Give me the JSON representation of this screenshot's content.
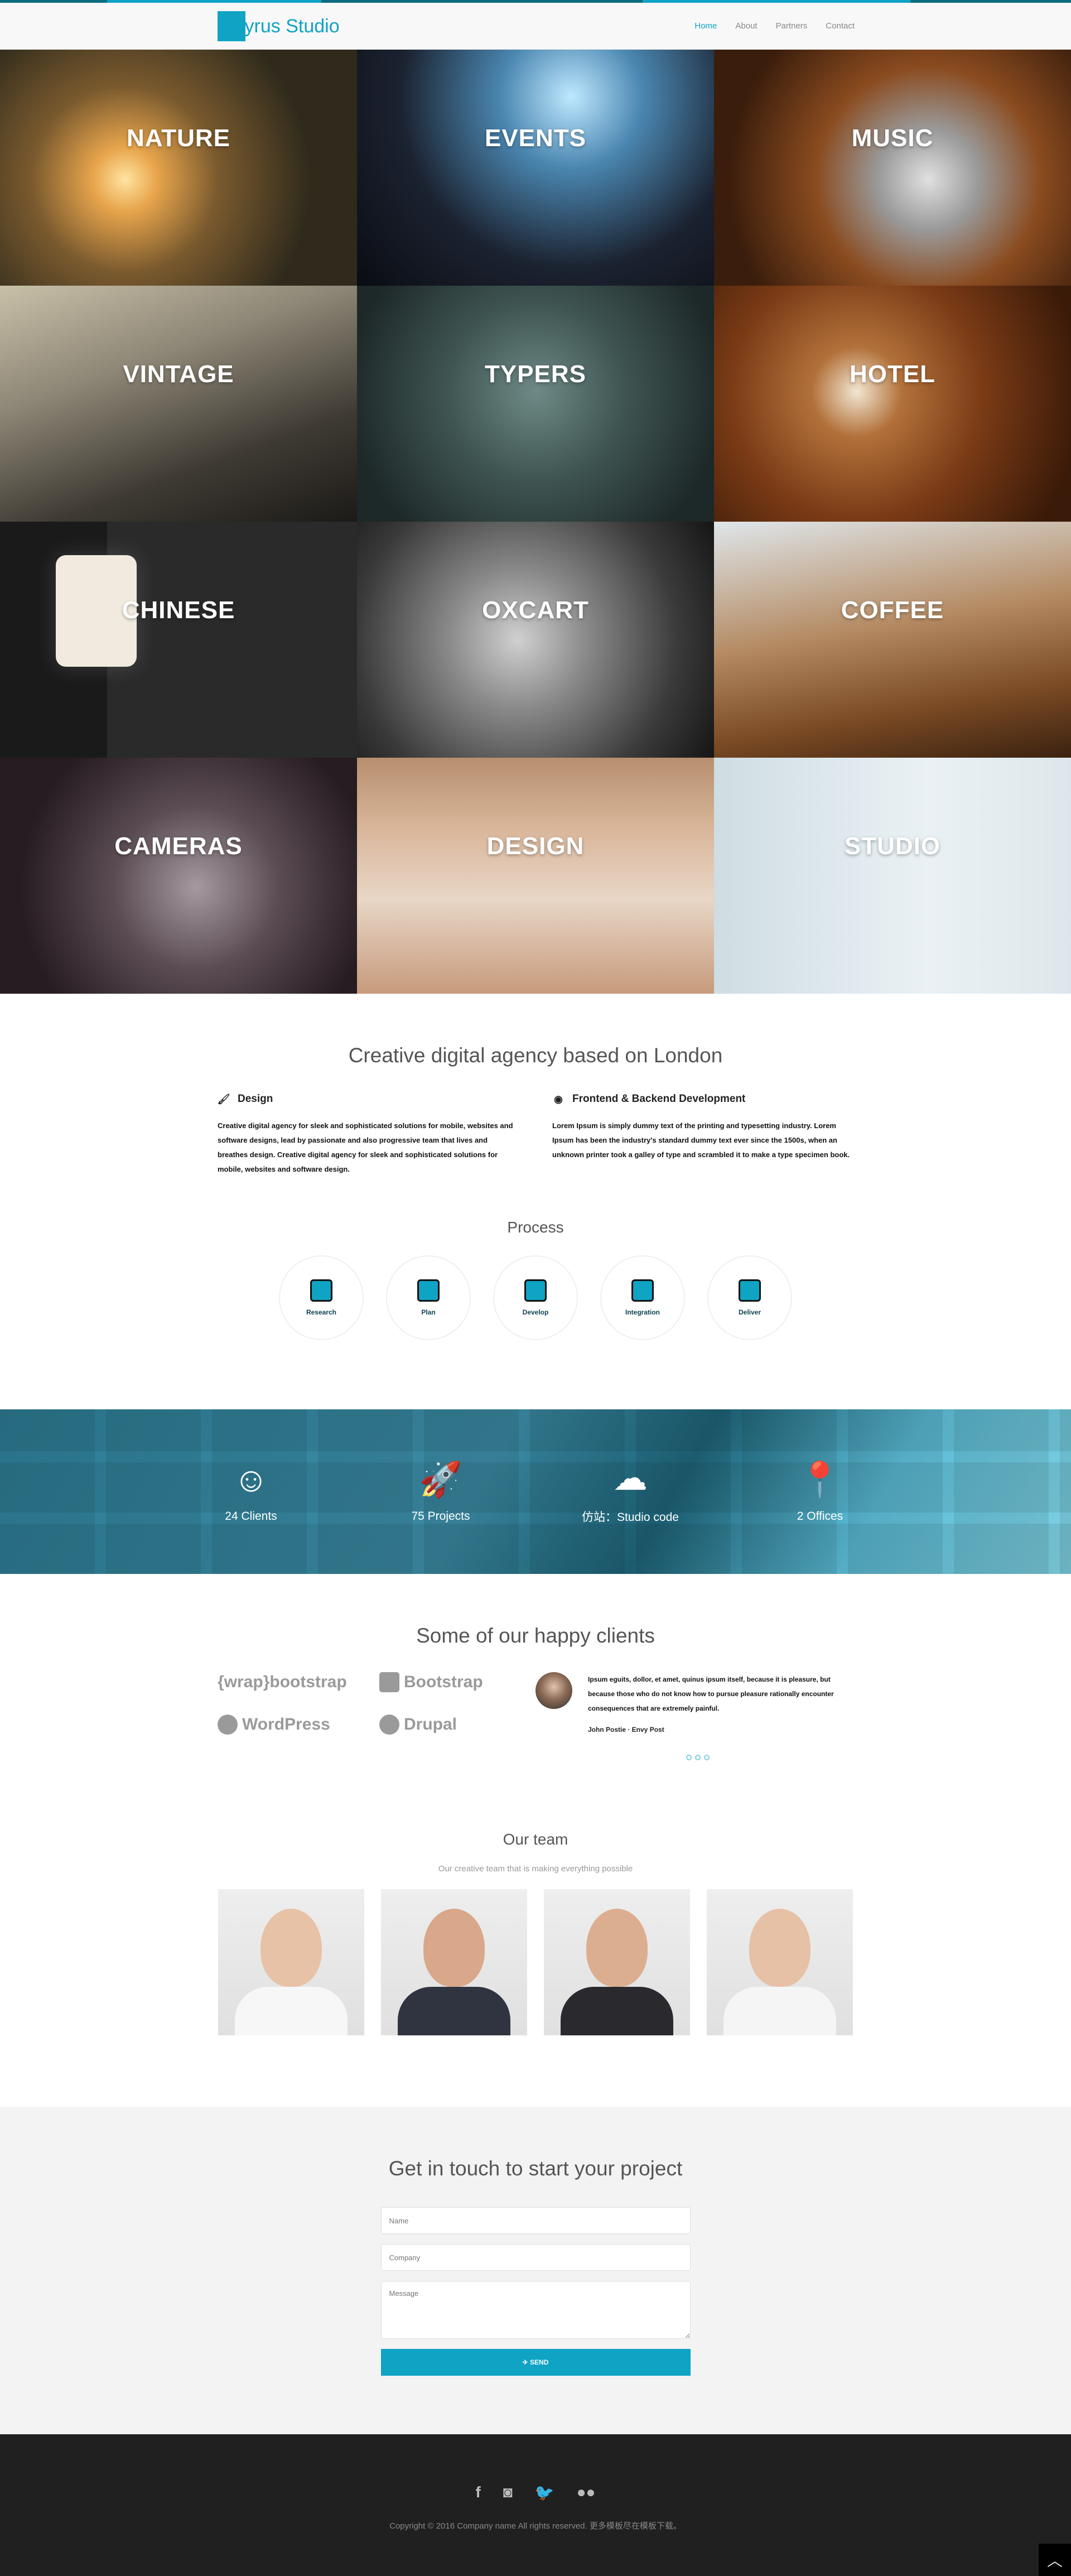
{
  "nav": {
    "brand": "Cyrus Studio",
    "links": [
      "Home",
      "About",
      "Partners",
      "Contact"
    ]
  },
  "tiles": [
    "NATURE",
    "EVENTS",
    "MUSIC",
    "VINTAGE",
    "TYPERS",
    "HOTEL",
    "CHINESE",
    "OXCART",
    "COFFEE",
    "CAMERAS",
    "DESIGN",
    "STUDIO"
  ],
  "agency": {
    "title": "Creative digital agency based on London",
    "services": [
      {
        "icon": "paint-brush-icon",
        "title": "Design",
        "text": "Creative digital agency for sleek and sophisticated solutions for mobile, websites and software designs, lead by passionate and also progressive team that lives and breathes design. Creative digital agency for sleek and sophisticated solutions for mobile, websites and software design."
      },
      {
        "icon": "code-icon",
        "title": "Frontend & Backend Development",
        "text": "Lorem Ipsum is simply dummy text of the printing and typesetting industry. Lorem Ipsum has been the industry's standard dummy text ever since the 1500s, when an unknown printer took a galley of type and scrambled it to make a type specimen book."
      }
    ],
    "process_title": "Process",
    "steps": [
      "Research",
      "Plan",
      "Develop",
      "Integration",
      "Deliver"
    ]
  },
  "stats": [
    {
      "icon": "smile-icon",
      "label": "24 Clients"
    },
    {
      "icon": "rocket-icon",
      "label": "75 Projects"
    },
    {
      "icon": "cloud-download-icon",
      "label": "仿站：Studio code"
    },
    {
      "icon": "map-pin-icon",
      "label": "2 Offices"
    }
  ],
  "clients": {
    "title": "Some of our happy clients",
    "logos": [
      "{wrap}bootstrap",
      "Bootstrap",
      "WordPress",
      "Drupal"
    ],
    "testimonial": {
      "quote": "Ipsum eguits, dollor, et amet, quinus ipsum itself, because it is pleasure, but because those who do not know how to pursue pleasure rationally encounter consequences that are extremely painful.",
      "author": "John Postie · Envy Post"
    }
  },
  "team": {
    "title": "Our team",
    "subtitle": "Our creative team that is making everything possible"
  },
  "contact": {
    "title": "Get in touch to start your project",
    "name_placeholder": "Name",
    "company_placeholder": "Company",
    "message_placeholder": "Message",
    "send_label": "✈ SEND"
  },
  "footer": {
    "social": [
      "facebook-icon",
      "instagram-icon",
      "twitter-icon",
      "flickr-icon"
    ],
    "copyright": "Copyright © 2016 Company name All rights reserved.  更多模板尽在模板下载。"
  },
  "colors": {
    "accent": "#0fa3c4",
    "footer_bg": "#202020",
    "contact_bg": "#f3f3f3"
  }
}
